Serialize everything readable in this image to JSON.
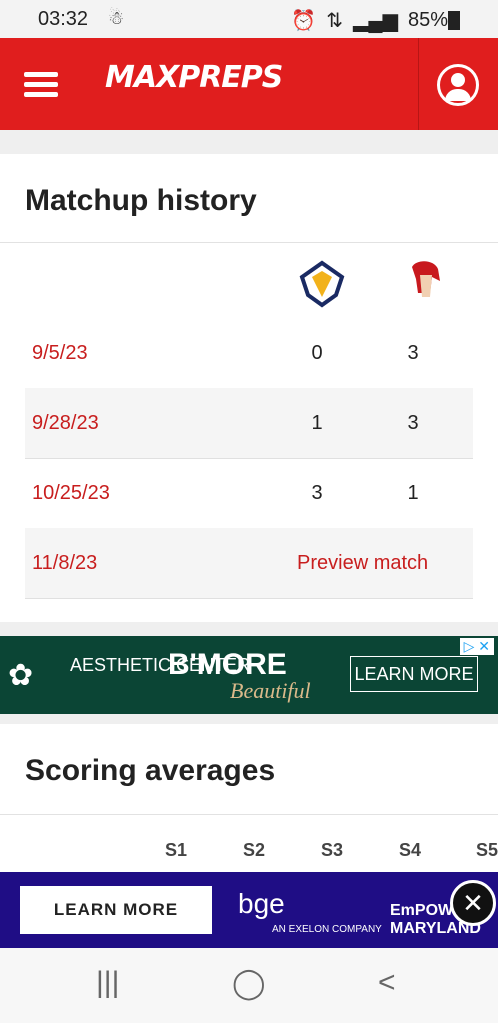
{
  "status": {
    "time": "03:32",
    "battery": "85%"
  },
  "header": {
    "logo": "MAXPREPS"
  },
  "matchup": {
    "title": "Matchup history",
    "rows": [
      {
        "date": "9/5/23",
        "s1": "0",
        "s2": "3"
      },
      {
        "date": "9/28/23",
        "s1": "1",
        "s2": "3"
      },
      {
        "date": "10/25/23",
        "s1": "3",
        "s2": "1"
      },
      {
        "date": "11/8/23",
        "preview": "Preview match"
      }
    ]
  },
  "ad1": {
    "aesthetic": "AESTHETIC CENTER",
    "bmore": "B'MORE",
    "beautiful": "Beautiful",
    "learn": "LEARN MORE"
  },
  "scoring": {
    "title": "Scoring averages",
    "cols": [
      "S1",
      "S2",
      "S3",
      "S4",
      "S5"
    ]
  },
  "ad2": {
    "learn": "LEARN MORE",
    "bge": "bge",
    "exelon": "AN EXELON COMPANY",
    "empower": "EmPOWER MARYLAND"
  }
}
